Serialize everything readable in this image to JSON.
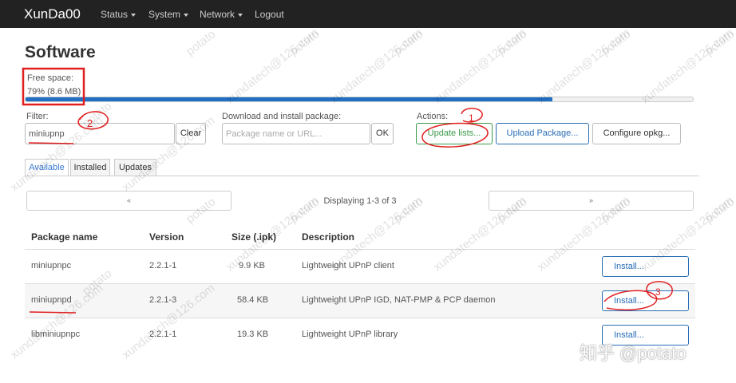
{
  "navbar": {
    "brand": "XunDa00",
    "items": [
      {
        "label": "Status",
        "dropdown": true
      },
      {
        "label": "System",
        "dropdown": true
      },
      {
        "label": "Network",
        "dropdown": true
      },
      {
        "label": "Logout",
        "dropdown": false
      }
    ]
  },
  "page": {
    "title": "Software",
    "free_space_label": "Free space:",
    "free_space_value": "79% (8.6 MB)",
    "free_space_fraction": 0.79
  },
  "filter": {
    "label": "Filter:",
    "value": "miniupnp",
    "clear_label": "Clear"
  },
  "download": {
    "label": "Download and install package:",
    "placeholder": "Package name or URL...",
    "ok_label": "OK"
  },
  "actions": {
    "label": "Actions:",
    "update_lists": "Update lists...",
    "upload_package": "Upload Package...",
    "configure": "Configure opkg..."
  },
  "tabs": [
    "Available",
    "Installed",
    "Updates"
  ],
  "pager": {
    "prev": "«",
    "next": "»",
    "text": "Displaying 1-3 of 3"
  },
  "table": {
    "headers": [
      "Package name",
      "Version",
      "Size (.ipk)",
      "Description"
    ],
    "rows": [
      {
        "name": "miniupnpc",
        "version": "2.2.1-1",
        "size": "9.9 KB",
        "description": "Lightweight UPnP client",
        "action": "Install..."
      },
      {
        "name": "miniupnpd",
        "version": "2.2.1-3",
        "size": "58.4 KB",
        "description": "Lightweight UPnP IGD, NAT-PMP & PCP daemon",
        "action": "Install..."
      },
      {
        "name": "libminiupnpc",
        "version": "2.2.1-1",
        "size": "19.3 KB",
        "description": "Lightweight UPnP library",
        "action": "Install..."
      }
    ]
  },
  "annotations": [
    "1",
    "2",
    "3"
  ],
  "watermark": {
    "text": "xundatech@126.com",
    "secondary": "potato",
    "zhihu": "知乎 @potato"
  },
  "colors": {
    "navbar": "#222222",
    "progress": "#2170c4",
    "accent_blue": "#2a6db5",
    "accent_green": "#3a9a4a",
    "annotation_red": "#e02020"
  }
}
